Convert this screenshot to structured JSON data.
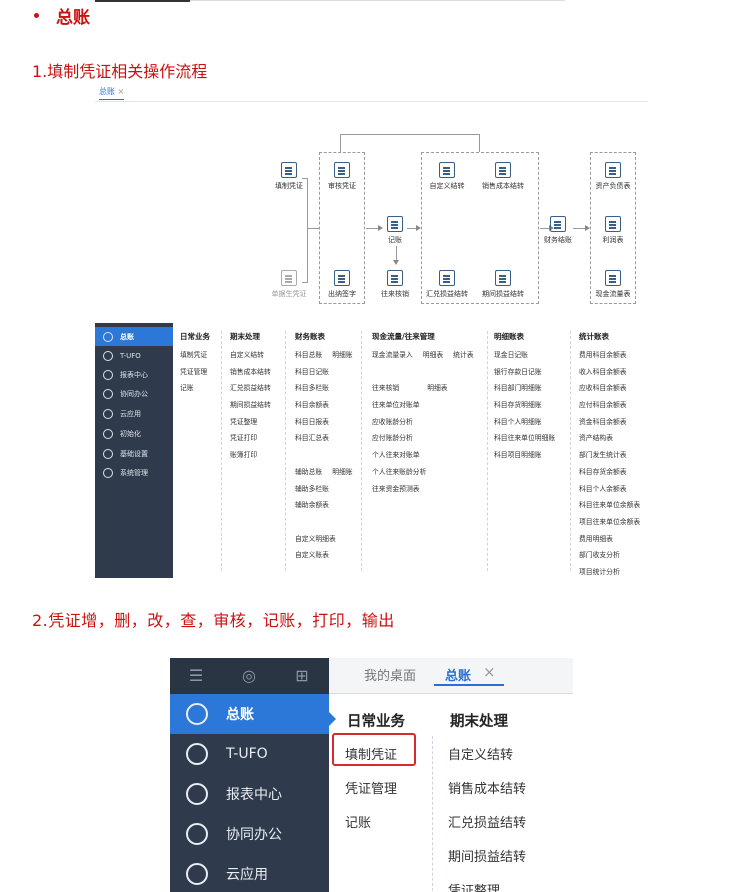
{
  "section_title": "总账",
  "step1_title": "1.填制凭证相关操作流程",
  "step2_title": "2.凭证增，删，改，查，审核，记账，打印，输出",
  "flow": {
    "tab": "总账",
    "tab_close": "×",
    "nodes": {
      "fill": "填制凭证",
      "single_gen": "单据生凭证",
      "audit": "审核凭证",
      "cashier_sign": "出纳签字",
      "post": "记账",
      "ar_ap_writeoff": "往来核销",
      "custom_transfer": "自定义结转",
      "sales_cost_transfer": "销售成本结转",
      "fx_gain_transfer": "汇兑损益结转",
      "period_gain_transfer": "期间损益结转",
      "month_close": "财务结账",
      "balance_sheet": "资产负债表",
      "income_statement": "利润表",
      "cash_flow": "现金流量表"
    }
  },
  "menu_small": {
    "sidebar": [
      {
        "label": "总账",
        "icon": "ledger-icon"
      },
      {
        "label": "T-UFO",
        "icon": "ufo-icon"
      },
      {
        "label": "报表中心",
        "icon": "report-icon"
      },
      {
        "label": "协同办公",
        "icon": "collab-icon"
      },
      {
        "label": "云应用",
        "icon": "cloud-icon"
      },
      {
        "label": "初始化",
        "icon": "init-icon"
      },
      {
        "label": "基础设置",
        "icon": "settings-icon"
      },
      {
        "label": "系统管理",
        "icon": "system-icon"
      }
    ],
    "columns": [
      {
        "header": "日常业务",
        "items": [
          "填制凭证",
          "凭证管理",
          "记账"
        ]
      },
      {
        "header": "期末处理",
        "items": [
          "自定义结转",
          "销售成本结转",
          "汇兑损益结转",
          "期间损益结转",
          "凭证整理",
          "凭证打印",
          "账簿打印"
        ]
      },
      {
        "header": "财务账表",
        "items": [
          "科目总账",
          "明细账",
          "科目日记账",
          "科目多栏账",
          "科目余额表",
          "科目日报表",
          "科目汇总表",
          "辅助总账",
          "明细账",
          "辅助多栏账",
          "辅助余额表",
          "自定义明细表",
          "自定义账表"
        ]
      },
      {
        "header": "现金流量/往来管理",
        "items": [
          "现金流量录入",
          "明细表",
          "统计表",
          "往来核销",
          "明细表",
          "往来单位对账单",
          "应收账龄分析",
          "应付账龄分析",
          "个人往来对账单",
          "个人往来账龄分析",
          "往来资金预测表"
        ]
      },
      {
        "header": "明细账表",
        "items": [
          "现金日记账",
          "银行存款日记账",
          "科目部门明细账",
          "科目存货明细账",
          "科目个人明细账",
          "科目往来单位明细账",
          "科目项目明细账"
        ]
      },
      {
        "header": "统计账表",
        "items": [
          "费用科目余额表",
          "收入科目余额表",
          "应收科目余额表",
          "应付科目余额表",
          "资金科目余额表",
          "资产结构表",
          "部门发生统计表",
          "科目存货余额表",
          "科目个人余额表",
          "科目往来单位余额表",
          "项目往来单位余额表",
          "费用明细表",
          "部门收支分析",
          "项目统计分析"
        ]
      }
    ]
  },
  "menu_zoom": {
    "top_icons": [
      "menu-icon",
      "search-icon",
      "add-icon"
    ],
    "tabs": {
      "desktop": "我的桌面",
      "ledger": "总账",
      "close": "×"
    },
    "sidebar": [
      {
        "label": "总账"
      },
      {
        "label": "T-UFO"
      },
      {
        "label": "报表中心"
      },
      {
        "label": "协同办公"
      },
      {
        "label": "云应用"
      }
    ],
    "col1_header": "日常业务",
    "col1_items": [
      "填制凭证",
      "凭证管理",
      "记账"
    ],
    "col2_header": "期末处理",
    "col2_items": [
      "自定义结转",
      "销售成本结转",
      "汇兑损益结转",
      "期间损益结转",
      "凭证整理"
    ],
    "highlight_color": "#d62b2b"
  }
}
